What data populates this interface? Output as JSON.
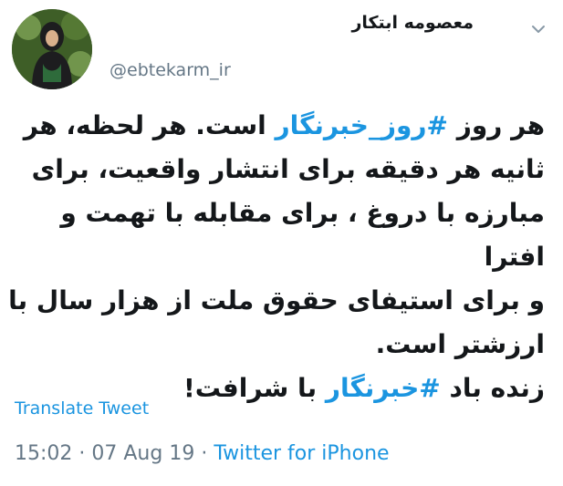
{
  "author": {
    "display_name": "معصومه ابتکار",
    "handle": "@ebtekarm_ir"
  },
  "tweet": {
    "line1_before": "هر روز ",
    "line1_hashtag": "#روز_خبرنگار",
    "line1_after": " است. هر لحظه، هر",
    "line2": "ثانیه هر دقیقه برای انتشار واقعیت، برای",
    "line3": "مبارزه با دروغ ، برای مقابله با تهمت و افترا",
    "line4": "و برای استیفای حقوق ملت از هزار سال با",
    "line5": "ارزشتر است.",
    "line6_before": "زنده باد ",
    "line6_hashtag": "#خبرنگار",
    "line6_after": " با شرافت!"
  },
  "translate_label": "Translate Tweet",
  "meta": {
    "time": "15:02",
    "separator1": " · ",
    "date": "07 Aug 19",
    "separator2": " · ",
    "source": "Twitter for iPhone"
  },
  "colors": {
    "link": "#1b95e0",
    "secondary": "#657786",
    "text": "#14171a"
  },
  "icons": {
    "menu": "chevron-down-icon",
    "avatar": "profile-photo"
  }
}
